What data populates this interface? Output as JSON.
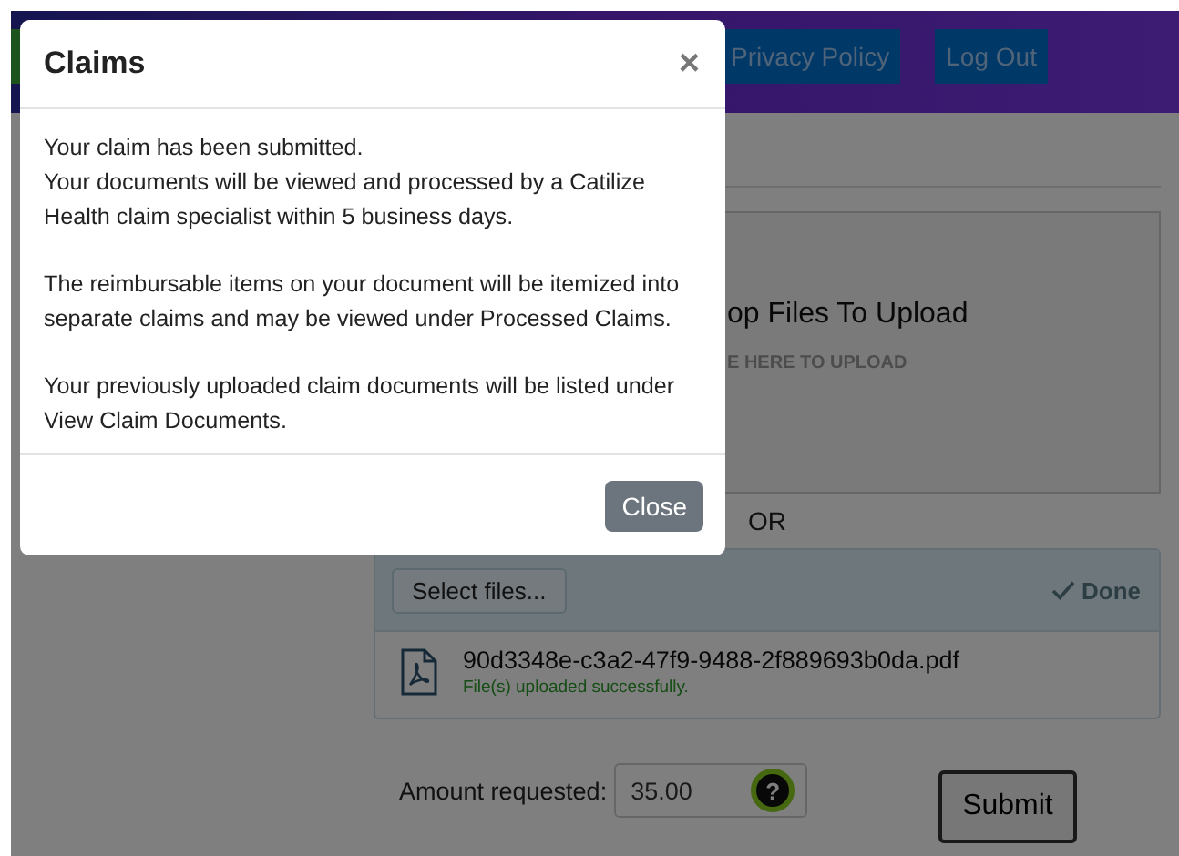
{
  "header": {
    "nav": [
      {
        "label": "Privacy Policy"
      },
      {
        "label": "Log Out"
      }
    ]
  },
  "upload": {
    "drop_title": "op Files To Upload",
    "drop_hint": "E HERE TO UPLOAD",
    "or": "OR",
    "select_button": "Select files...",
    "done": "Done",
    "file": {
      "name": "90d3348e-c3a2-47f9-9488-2f889693b0da.pdf",
      "status": "File(s) uploaded successfully."
    }
  },
  "amount": {
    "label": "Amount requested:",
    "value": "35.00",
    "help": "?"
  },
  "submit": "Submit",
  "modal": {
    "title": "Claims",
    "close_icon": "×",
    "paragraphs": [
      [
        "Your claim has been submitted.",
        "Your documents will be viewed and processed by a Catilize Health claim specialist within 5 business days."
      ],
      [
        "The reimbursable items on your document will be itemized into separate claims and may be viewed under Processed Claims."
      ],
      [
        "Your previously uploaded claim documents will be listed under View Claim Documents."
      ]
    ],
    "close_button": "Close"
  }
}
